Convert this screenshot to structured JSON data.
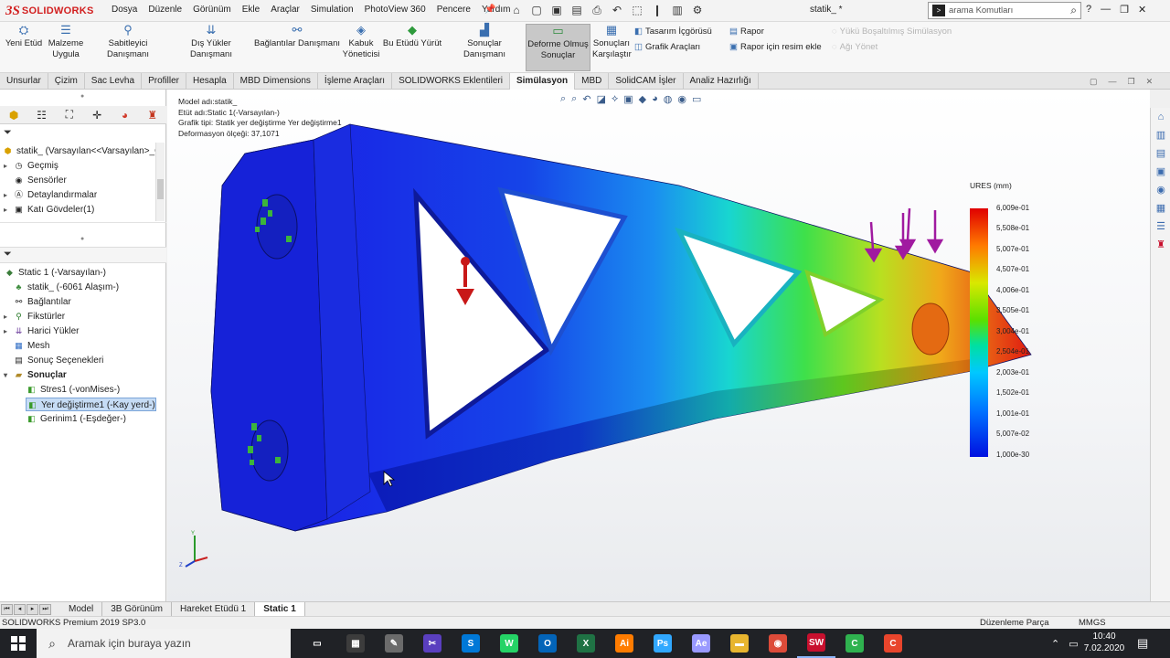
{
  "app": {
    "brand_ds": "3S",
    "brand_name": "SOLIDWORKS",
    "document_title": "statik_ *",
    "menu": [
      "Dosya",
      "Düzenle",
      "Görünüm",
      "Ekle",
      "Araçlar",
      "Simulation",
      "PhotoView 360",
      "Pencere",
      "Yardım"
    ],
    "search_placeholder": "arama Komutları"
  },
  "ribbon": {
    "yeni_etud": "Yeni Etüd",
    "malzeme_1": "Malzeme",
    "malzeme_2": "Uygula",
    "sabitleyici": "Sabitleyici Danışmanı",
    "dis_yukler": "Dış Yükler Danışmanı",
    "baglantilar": "Bağlantılar Danışmanı",
    "kabuk_1": "Kabuk",
    "kabuk_2": "Yöneticisi",
    "etudu_yurut": "Bu Etüdü Yürüt",
    "sonuclar": "Sonuçlar Danışmanı",
    "deforme_1": "Deforme Olmuş",
    "deforme_2": "Sonuçlar",
    "karsilastir_1": "Sonuçları",
    "karsilastir_2": "Karşılaştır",
    "tasarim": "Tasarım İçgörüsü",
    "grafik": "Grafik Araçları",
    "rapor": "Rapor",
    "rapor_resim": "Rapor için resim ekle",
    "yuku_bosalt": "Yükü Boşaltılmış Simülasyon",
    "agi_yonet": "Ağı Yönet"
  },
  "tabs": [
    "Unsurlar",
    "Çizim",
    "Sac Levha",
    "Profiller",
    "Hesapla",
    "MBD Dimensions",
    "İşleme Araçları",
    "SOLIDWORKS Eklentileri",
    "Simülasyon",
    "MBD",
    "SolidCAM İşler",
    "Analiz Hazırlığı"
  ],
  "active_tab": "Simülasyon",
  "feature_tree": {
    "root": "statik_ (Varsayılan<<Varsayılan>_G",
    "items": [
      "Geçmiş",
      "Sensörler",
      "Detaylandırmalar",
      "Katı Gövdeler(1)"
    ]
  },
  "sim_tree": {
    "root": "Static 1 (-Varsayılan-)",
    "part": "statik_ (-6061 Alaşım-)",
    "baglantilar": "Bağlantılar",
    "fiksturler": "Fikstürler",
    "harici": "Harici Yükler",
    "mesh": "Mesh",
    "sonuc_secenek": "Sonuç Seçenekleri",
    "sonuclar": "Sonuçlar",
    "results": [
      "Stres1 (-vonMises-)",
      "Yer değiştirme1 (-Kay yerd-)",
      "Gerinim1 (-Eşdeğer-)"
    ]
  },
  "viewport": {
    "model_name": "Model adı:statik_",
    "study_name": "Etüt adı:Static 1(-Varsayılan-)",
    "plot_type": "Grafik tipi: Statik yer değiştirme Yer değiştirme1",
    "deform_scale": "Deformasyon ölçeği: 37,1071"
  },
  "legend": {
    "title": "URES (mm)",
    "labels": [
      "6,009e-01",
      "5,508e-01",
      "5,007e-01",
      "4,507e-01",
      "4,006e-01",
      "3,505e-01",
      "3,004e-01",
      "2,504e-01",
      "2,003e-01",
      "1,502e-01",
      "1,001e-01",
      "5,007e-02",
      "1,000e-30"
    ],
    "colors": {
      "max": "#e00000",
      "mid": "#5ae000",
      "min": "#0010e0"
    }
  },
  "bottom_tabs": [
    "Model",
    "3B Görünüm",
    "Hareket Etüdü 1",
    "Static 1"
  ],
  "active_bottom_tab": "Static 1",
  "status": {
    "left": "SOLIDWORKS Premium 2019 SP3.0",
    "mode": "Düzenleme Parça",
    "units": "MMGS"
  },
  "taskbar": {
    "search_text": "Aramak için buraya yazın",
    "time": "10:40",
    "date": "7.02.2020",
    "apps": [
      {
        "name": "task-view",
        "glyph": "▭",
        "color": "#202226"
      },
      {
        "name": "calculator",
        "glyph": "▦",
        "color": "#3c3c3c"
      },
      {
        "name": "paint",
        "glyph": "✎",
        "color": "#6b6b6b"
      },
      {
        "name": "snip",
        "glyph": "✂",
        "color": "#5a3fbf"
      },
      {
        "name": "skype",
        "glyph": "S",
        "color": "#0078d7"
      },
      {
        "name": "whatsapp",
        "glyph": "W",
        "color": "#25d366"
      },
      {
        "name": "outlook",
        "glyph": "O",
        "color": "#0364b8"
      },
      {
        "name": "excel",
        "glyph": "X",
        "color": "#1f7244"
      },
      {
        "name": "illustrator",
        "glyph": "Ai",
        "color": "#ff7c00"
      },
      {
        "name": "photoshop",
        "glyph": "Ps",
        "color": "#31a8ff"
      },
      {
        "name": "after-effects",
        "glyph": "Ae",
        "color": "#9999ff"
      },
      {
        "name": "file-explorer",
        "glyph": "▬",
        "color": "#e8b52f"
      },
      {
        "name": "chrome",
        "glyph": "◉",
        "color": "#dd4b39"
      },
      {
        "name": "solidworks",
        "glyph": "SW",
        "color": "#c8102e"
      },
      {
        "name": "camtasia",
        "glyph": "C",
        "color": "#2fb24f"
      },
      {
        "name": "camtasia-recorder",
        "glyph": "C",
        "color": "#e8452c"
      }
    ]
  }
}
